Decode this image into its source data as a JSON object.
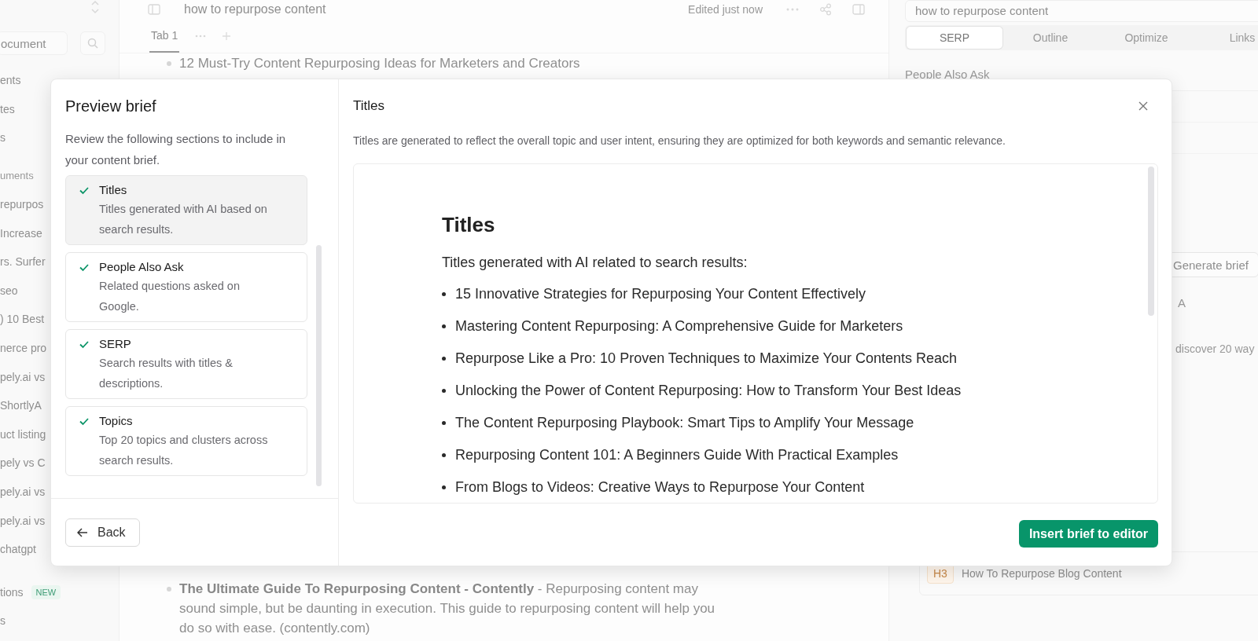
{
  "sidebar": {
    "search": {
      "placeholder": "ocument"
    },
    "items": [
      {
        "kind": "item",
        "label": "ents"
      },
      {
        "kind": "item",
        "label": "tes"
      },
      {
        "kind": "item",
        "label": "s"
      },
      {
        "kind": "header",
        "label": "uments"
      },
      {
        "kind": "item",
        "label": "repurpos"
      },
      {
        "kind": "item",
        "label": "Increase"
      },
      {
        "kind": "item",
        "label": "rs. Surfer"
      },
      {
        "kind": "item",
        "label": "seo"
      },
      {
        "kind": "item",
        "label": ") 10 Best"
      },
      {
        "kind": "item",
        "label": "nerce pro"
      },
      {
        "kind": "item",
        "label": "pely.ai vs"
      },
      {
        "kind": "item",
        "label": "ShortlyA"
      },
      {
        "kind": "item",
        "label": "uct listing"
      },
      {
        "kind": "item",
        "label": "pely vs C"
      },
      {
        "kind": "item",
        "label": "pely.ai vs"
      },
      {
        "kind": "item",
        "label": "pely.ai vs"
      },
      {
        "kind": "item",
        "label": "chatgpt"
      },
      {
        "kind": "gap",
        "label": "tions",
        "badge": "NEW"
      },
      {
        "kind": "item",
        "label": "s"
      }
    ]
  },
  "editor": {
    "title": "how to repurpose content",
    "status": "Edited just now",
    "tabs": [
      {
        "label": "Tab 1",
        "selected": true
      }
    ],
    "content": [
      {
        "text": "12 Must-Try Content Repurposing Ideas for Marketers and Creators"
      },
      {
        "text": "**The Ultimate Guide To Repurposing Content - Contently** - Repurposing content may sound simple, but be daunting in execution. This guide to repurposing content will help you do so with ease. (contently.com)"
      }
    ]
  },
  "right_panel": {
    "keyword": "how to repurpose content",
    "tabs": [
      {
        "label": "SERP",
        "selected": true
      },
      {
        "label": "Outline",
        "selected": false
      },
      {
        "label": "Optimize",
        "selected": false
      },
      {
        "label": "Links",
        "selected": false
      }
    ],
    "section_title": "People Also Ask",
    "generate_button": "Generate brief",
    "fragments": [
      "A",
      "discover 20 way"
    ],
    "outline": [
      {
        "level": "H3",
        "text": "How To Repurpose Blog Content"
      }
    ]
  },
  "modal": {
    "title": "Preview brief",
    "intro": "Review the following sections to include in your content brief.",
    "sections": [
      {
        "title": "Titles",
        "description": "Titles generated with AI based on search results.",
        "checked": true,
        "selected": true
      },
      {
        "title": "People Also Ask",
        "description": "Related questions asked on Google.",
        "checked": true,
        "selected": false
      },
      {
        "title": "SERP",
        "description": "Search results with titles & descriptions.",
        "checked": true,
        "selected": false
      },
      {
        "title": "Topics",
        "description": "Top 20 topics and clusters across search results.",
        "checked": true,
        "selected": false
      }
    ],
    "back_button": "Back",
    "preview": {
      "title": "Titles",
      "description": "Titles are generated to reflect the overall topic and user intent, ensuring they are optimized for both keywords and semantic relevance.",
      "heading": "Titles",
      "lead": "Titles generated with AI related to search results:",
      "items": [
        "15 Innovative Strategies for Repurposing Your Content Effectively",
        "Mastering Content Repurposing: A Comprehensive Guide for Marketers",
        "Repurpose Like a Pro: 10 Proven Techniques to Maximize Your Contents Reach",
        "Unlocking the Power of Content Repurposing: How to Transform Your Best Ideas",
        "The Content Repurposing Playbook: Smart Tips to Amplify Your Message",
        "Repurposing Content 101: A Beginners Guide With Practical Examples",
        "From Blogs to Videos: Creative Ways to Repurpose Your Content"
      ]
    },
    "primary_button": "Insert brief to editor"
  }
}
